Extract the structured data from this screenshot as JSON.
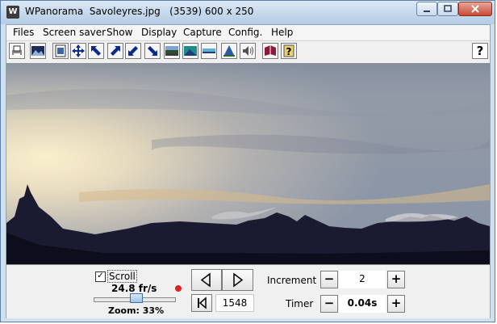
{
  "window": {
    "title": "WPanorama  Savoleyres.jpg   (3539) 600 x 250",
    "app_icon_glyph": "W"
  },
  "menu": {
    "items": [
      "Files",
      "Screen saver",
      "Show",
      "Display",
      "Capture",
      "Config.",
      "Help"
    ]
  },
  "toolbar": {
    "help_label": "?",
    "icons": [
      "print-icon",
      "picture-icon",
      "open-file-icon",
      "move-icon",
      "arrow-up-left-icon",
      "arrow-diagonal-icon",
      "arrow-down-left-icon",
      "arrow-down-right-icon",
      "panorama-icon",
      "panorama-blue-icon",
      "panorama-thin-icon",
      "pyramid-icon",
      "speaker-icon",
      "book-icon",
      "help-book-icon",
      "help-icon"
    ]
  },
  "controls": {
    "scroll_label": "Scroll",
    "scroll_checked": true,
    "fps": "24.8 fr/s",
    "zoom": "Zoom: 33%",
    "zoom_value": 0.33,
    "position": "1548",
    "increment_label": "Increment",
    "increment_value": "2",
    "timer_label": "Timer",
    "timer_value": "0.04s",
    "minus": "−",
    "plus": "+"
  },
  "colors": {
    "sky_top": "#9fa8b4",
    "sun_glow": "#f3e4b8",
    "mountain": "#141424"
  }
}
